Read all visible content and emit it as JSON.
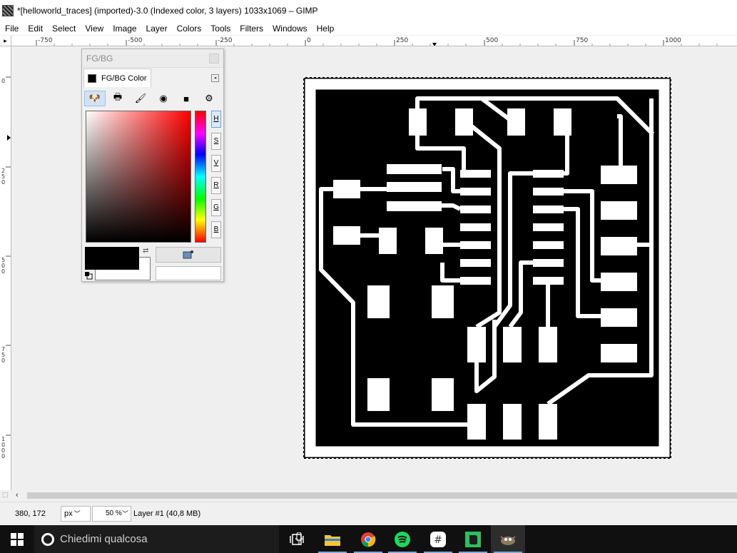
{
  "window": {
    "title": "*[helloworld_traces] (imported)-3.0 (Indexed color, 3 layers) 1033x1069 – GIMP"
  },
  "menu": [
    "File",
    "Edit",
    "Select",
    "View",
    "Image",
    "Layer",
    "Colors",
    "Tools",
    "Filters",
    "Windows",
    "Help"
  ],
  "ruler_top": [
    "-750",
    "-500",
    "-250",
    "0",
    "250",
    "500",
    "750",
    "1000"
  ],
  "ruler_left": [
    "0",
    "250",
    "500",
    "750",
    "1000"
  ],
  "dock": {
    "title": "FG/BG",
    "tab_label": "FG/BG Color",
    "channels": [
      "H",
      "S",
      "V",
      "R",
      "G",
      "B"
    ],
    "active_channel": "H",
    "foreground_color": "#000000",
    "background_color": "#ffffff"
  },
  "statusbar": {
    "coords": "380, 172",
    "unit": "px",
    "zoom": "50 %",
    "layer_info": "Layer #1 (40,8 MB)"
  },
  "taskbar": {
    "search_placeholder": "Chiedimi qualcosa",
    "apps": [
      "task-view",
      "file-explorer",
      "chrome",
      "spotify",
      "slack",
      "evernote",
      "gimp"
    ]
  }
}
